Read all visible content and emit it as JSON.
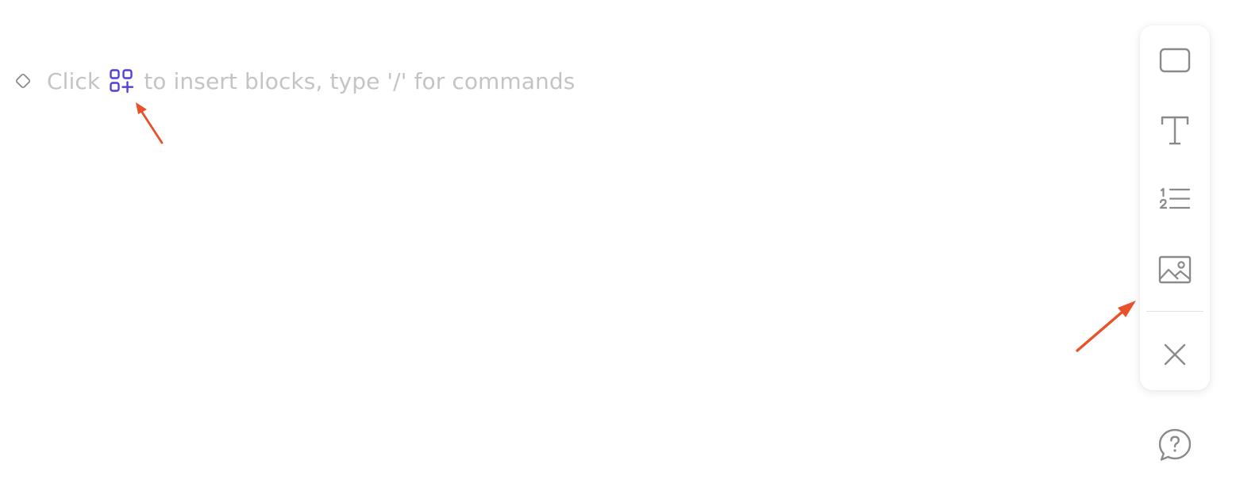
{
  "editor": {
    "placeholder": {
      "before_icon": "Click",
      "after_icon": "to insert blocks, type '/' for commands"
    },
    "block_handle_icon": "diamond-icon",
    "insert_icon": "add-block-grid-icon"
  },
  "toolbar": {
    "items": [
      {
        "icon": "rectangle-icon",
        "tooltip": ""
      },
      {
        "icon": "text-t-icon",
        "tooltip": ""
      },
      {
        "icon": "numbered-list-icon",
        "tooltip": ""
      },
      {
        "icon": "image-icon",
        "tooltip": ""
      }
    ],
    "close_icon": "close-icon"
  },
  "help": {
    "icon": "help-bubble-icon"
  },
  "colors": {
    "placeholder_text": "#c4c4c4",
    "accent": "#4f3fe0",
    "icon_gray": "#8a8a8a",
    "annotation_arrow": "#e8512a"
  }
}
